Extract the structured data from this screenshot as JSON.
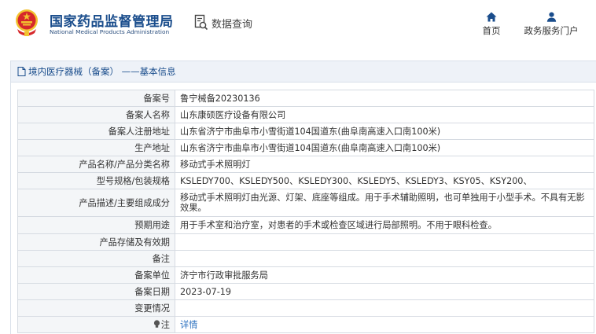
{
  "header": {
    "site_name": "国家药品监督管理局",
    "site_name_en": "National Medical Products Administration",
    "data_query_label": "数据查询",
    "nav": {
      "home_label": "首页",
      "portal_label": "政务服务门户"
    }
  },
  "panel": {
    "title": "境内医疗器械（备案） ——基本信息"
  },
  "record": {
    "rows": [
      {
        "label": "备案号",
        "value": "鲁宁械备20230136"
      },
      {
        "label": "备案人名称",
        "value": "山东康硕医疗设备有限公司"
      },
      {
        "label": "备案人注册地址",
        "value": "山东省济宁市曲阜市小雪街道104国道东(曲阜南高速入口南100米)"
      },
      {
        "label": "生产地址",
        "value": "山东省济宁市曲阜市小雪街道104国道东(曲阜南高速入口南100米)"
      },
      {
        "label": "产品名称/产品分类名称",
        "value": "移动式手术照明灯"
      },
      {
        "label": "型号规格/包装规格",
        "value": "KSLEDY700、KSLEDY500、KSLEDY300、KSLEDY5、KSLEDY3、KSY05、KSY200、"
      },
      {
        "label": "产品描述/主要组成成分",
        "value": "移动式手术照明灯由光源、灯架、底座等组成。用于手术辅助照明，也可单独用于小型手术。不具有无影效果。"
      },
      {
        "label": "预期用途",
        "value": "用于手术室和治疗室，对患者的手术或检查区域进行局部照明。不用于眼科检查。"
      },
      {
        "label": "产品存储及有效期",
        "value": ""
      },
      {
        "label": "备注",
        "value": ""
      },
      {
        "label": "备案单位",
        "value": "济宁市行政审批服务局"
      },
      {
        "label": "备案日期",
        "value": "2023-07-19"
      },
      {
        "label": "变更情况",
        "value": ""
      }
    ],
    "note_label": "注",
    "details_link": "详情"
  },
  "colors": {
    "brand_blue": "#1a4d8c",
    "link_blue": "#2a6fbf",
    "emblem_red": "#d6282b",
    "emblem_gold": "#f2c230",
    "label_bg": "#f4f6f8",
    "border": "#d6dbe2"
  },
  "icons": [
    "national-emblem-icon",
    "data-query-icon",
    "home-icon",
    "user-icon",
    "document-icon",
    "lightbulb-icon"
  ]
}
